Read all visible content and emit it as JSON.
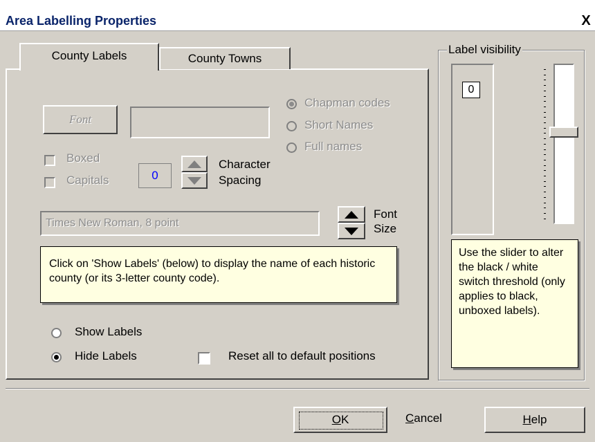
{
  "window": {
    "title": "Area Labelling Properties",
    "close_glyph": "X"
  },
  "tabs": [
    {
      "label": "County Labels",
      "selected": true
    },
    {
      "label": "County Towns",
      "selected": false
    }
  ],
  "font_button": {
    "label": "Font"
  },
  "font_preview": {
    "value": ""
  },
  "label_type": {
    "options": [
      "Chapman codes",
      "Short Names",
      "Full names"
    ],
    "selected": "Chapman codes"
  },
  "boxed": {
    "label": "Boxed",
    "checked": false
  },
  "capitals": {
    "label": "Capitals",
    "checked": false
  },
  "character_spacing": {
    "value": "0",
    "label_line1": "Character",
    "label_line2": "Spacing"
  },
  "font_name": {
    "value": "Times New Roman, 8 point"
  },
  "font_size": {
    "label_line1": "Font",
    "label_line2": "Size"
  },
  "info_note": {
    "text": "Click on 'Show Labels' (below) to display the name of each historic county (or its 3-letter county code)."
  },
  "show_labels": {
    "label": "Show Labels",
    "selected": false
  },
  "hide_labels": {
    "label": "Hide Labels",
    "selected": true
  },
  "reset_positions": {
    "label": "Reset all to default positions",
    "checked": false
  },
  "label_visibility": {
    "title": "Label visibility",
    "value": "0",
    "slider_level": 0.42,
    "note": "Use the slider to alter the black / white switch threshold (only applies to black, unboxed labels)."
  },
  "buttons": {
    "ok": {
      "mnemonic": "O",
      "rest": "K"
    },
    "cancel": {
      "mnemonic": "C",
      "rest": "ancel"
    },
    "help": {
      "mnemonic": "H",
      "rest": "elp"
    }
  },
  "colors": {
    "title_text": "#0a246a",
    "spacing_value": "#0000ff",
    "note_bg": "#ffffe1",
    "dialog_bg": "#d4d0c8"
  }
}
